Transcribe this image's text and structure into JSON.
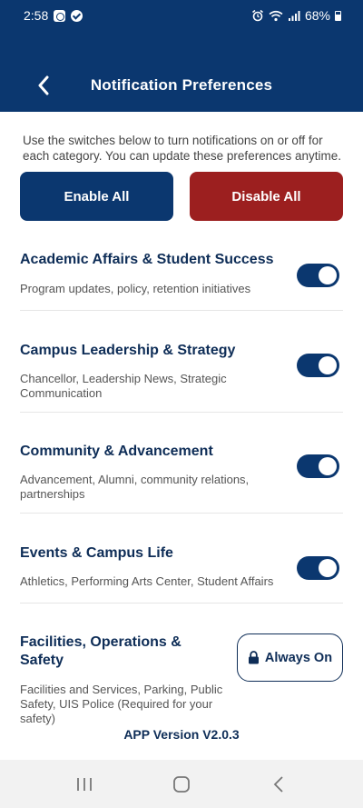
{
  "status_bar": {
    "time": "2:58",
    "battery_percent": "68%",
    "left_icons": [
      "notification-app-icon",
      "check-circle-icon"
    ],
    "right_icons": [
      "alarm-icon",
      "wifi-icon",
      "signal-icon",
      "battery-icon"
    ]
  },
  "header": {
    "title": "Notification Preferences",
    "background_color": "#0b376f",
    "back_icon": "chevron-left-icon"
  },
  "intro_text": "Use the switches below to turn notifications on or off for each category. You can update these preferences anytime.",
  "actions": {
    "enable_all_label": "Enable All",
    "disable_all_label": "Disable All",
    "enable_color": "#0b376f",
    "disable_color": "#9c1f1f"
  },
  "categories": [
    {
      "title": "Academic Affairs & Student Success",
      "description": "Program updates, policy, retention initiatives",
      "enabled": true
    },
    {
      "title": "Campus Leadership & Strategy",
      "description": "Chancellor, Leadership News, Strategic Communication",
      "enabled": true
    },
    {
      "title": "Community & Advancement",
      "description": "Advancement, Alumni, community relations, partnerships",
      "enabled": true
    },
    {
      "title": "Events & Campus Life",
      "description": "Athletics, Performing Arts Center, Student Affairs",
      "enabled": true
    },
    {
      "title": "Facilities, Operations & Safety",
      "description": "Facilities and Services, Parking, Public Safety, UIS Police (Required for your safety)",
      "always_on_label": "Always On",
      "lock_icon": "lock-icon"
    }
  ],
  "app_version": "APP Version V2.0.3",
  "nav_bar": {
    "icons": [
      "recent-apps-icon",
      "home-icon",
      "back-icon"
    ]
  }
}
